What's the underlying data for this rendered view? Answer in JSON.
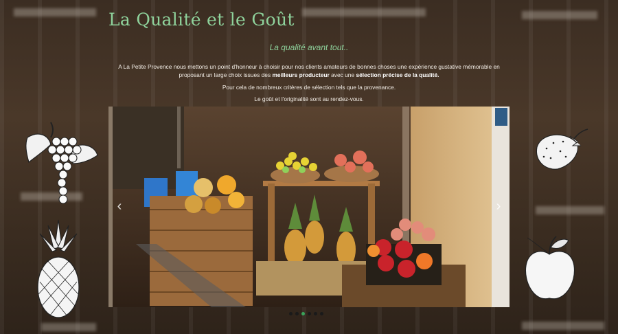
{
  "header": {
    "title": "La Qualité et le Goût",
    "subtitle": "La qualité avant tout.."
  },
  "intro": {
    "part1": "A La Petite Provence nous mettons un point d'honneur à choisir pour nos clients amateurs de bonnes choses une expérience gustative mémorable en proposant un large choix issues des ",
    "bold1": "meilleurs producteur",
    "part2": " avec une ",
    "bold2": "sélection précise de la qualité.",
    "line2": "Pour cela de nombreux critères de sélection tels que la provenance.",
    "line3": "Le goût et l'originalité sont au rendez-vous."
  },
  "carousel": {
    "prev_icon": "chevron-left-icon",
    "next_icon": "chevron-right-icon",
    "prev_glyph": "‹",
    "next_glyph": "›",
    "slide_count": 6,
    "active_index": 2
  },
  "decorations": [
    "grapes-icon",
    "pineapple-icon",
    "strawberry-icon",
    "apple-icon"
  ],
  "colors": {
    "title": "#8fd39c",
    "text": "#f4efe8",
    "active_dot": "#3aa35a"
  }
}
